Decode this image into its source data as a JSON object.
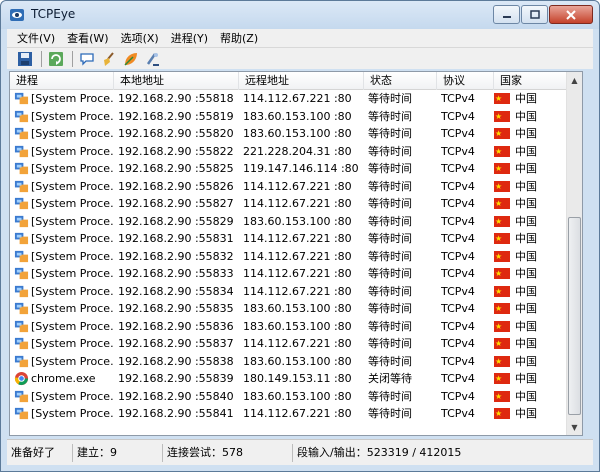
{
  "window": {
    "title": "TCPEye"
  },
  "menu": [
    "文件(V)",
    "查看(W)",
    "选项(X)",
    "进程(Y)",
    "帮助(Z)"
  ],
  "toolbar": [
    "save-icon",
    "refresh-icon",
    "chat-icon",
    "broom-icon",
    "leaf-icon",
    "tool-icon"
  ],
  "columns": [
    "进程",
    "本地地址",
    "远程地址",
    "状态",
    "协议",
    "国家"
  ],
  "rows": [
    {
      "process": "[System Proce...",
      "icon": "system-process-icon",
      "local": "192.168.2.90 :55818",
      "remote": "114.112.67.221 :80",
      "state": "等待时间",
      "protocol": "TCPv4",
      "country": "中国"
    },
    {
      "process": "[System Proce...",
      "icon": "system-process-icon",
      "local": "192.168.2.90 :55819",
      "remote": "183.60.153.100 :80",
      "state": "等待时间",
      "protocol": "TCPv4",
      "country": "中国"
    },
    {
      "process": "[System Proce...",
      "icon": "system-process-icon",
      "local": "192.168.2.90 :55820",
      "remote": "183.60.153.100 :80",
      "state": "等待时间",
      "protocol": "TCPv4",
      "country": "中国"
    },
    {
      "process": "[System Proce...",
      "icon": "system-process-icon",
      "local": "192.168.2.90 :55822",
      "remote": "221.228.204.31 :80",
      "state": "等待时间",
      "protocol": "TCPv4",
      "country": "中国"
    },
    {
      "process": "[System Proce...",
      "icon": "system-process-icon",
      "local": "192.168.2.90 :55825",
      "remote": "119.147.146.114 :80",
      "state": "等待时间",
      "protocol": "TCPv4",
      "country": "中国"
    },
    {
      "process": "[System Proce...",
      "icon": "system-process-icon",
      "local": "192.168.2.90 :55826",
      "remote": "114.112.67.221 :80",
      "state": "等待时间",
      "protocol": "TCPv4",
      "country": "中国"
    },
    {
      "process": "[System Proce...",
      "icon": "system-process-icon",
      "local": "192.168.2.90 :55827",
      "remote": "114.112.67.221 :80",
      "state": "等待时间",
      "protocol": "TCPv4",
      "country": "中国"
    },
    {
      "process": "[System Proce...",
      "icon": "system-process-icon",
      "local": "192.168.2.90 :55829",
      "remote": "183.60.153.100 :80",
      "state": "等待时间",
      "protocol": "TCPv4",
      "country": "中国"
    },
    {
      "process": "[System Proce...",
      "icon": "system-process-icon",
      "local": "192.168.2.90 :55831",
      "remote": "114.112.67.221 :80",
      "state": "等待时间",
      "protocol": "TCPv4",
      "country": "中国"
    },
    {
      "process": "[System Proce...",
      "icon": "system-process-icon",
      "local": "192.168.2.90 :55832",
      "remote": "114.112.67.221 :80",
      "state": "等待时间",
      "protocol": "TCPv4",
      "country": "中国"
    },
    {
      "process": "[System Proce...",
      "icon": "system-process-icon",
      "local": "192.168.2.90 :55833",
      "remote": "114.112.67.221 :80",
      "state": "等待时间",
      "protocol": "TCPv4",
      "country": "中国"
    },
    {
      "process": "[System Proce...",
      "icon": "system-process-icon",
      "local": "192.168.2.90 :55834",
      "remote": "114.112.67.221 :80",
      "state": "等待时间",
      "protocol": "TCPv4",
      "country": "中国"
    },
    {
      "process": "[System Proce...",
      "icon": "system-process-icon",
      "local": "192.168.2.90 :55835",
      "remote": "183.60.153.100 :80",
      "state": "等待时间",
      "protocol": "TCPv4",
      "country": "中国"
    },
    {
      "process": "[System Proce...",
      "icon": "system-process-icon",
      "local": "192.168.2.90 :55836",
      "remote": "183.60.153.100 :80",
      "state": "等待时间",
      "protocol": "TCPv4",
      "country": "中国"
    },
    {
      "process": "[System Proce...",
      "icon": "system-process-icon",
      "local": "192.168.2.90 :55837",
      "remote": "114.112.67.221 :80",
      "state": "等待时间",
      "protocol": "TCPv4",
      "country": "中国"
    },
    {
      "process": "[System Proce...",
      "icon": "system-process-icon",
      "local": "192.168.2.90 :55838",
      "remote": "183.60.153.100 :80",
      "state": "等待时间",
      "protocol": "TCPv4",
      "country": "中国"
    },
    {
      "process": "chrome.exe",
      "icon": "chrome-icon",
      "local": "192.168.2.90 :55839",
      "remote": "180.149.153.11 :80",
      "state": "关闭等待",
      "protocol": "TCPv4",
      "country": "中国"
    },
    {
      "process": "[System Proce...",
      "icon": "system-process-icon",
      "local": "192.168.2.90 :55840",
      "remote": "183.60.153.100 :80",
      "state": "等待时间",
      "protocol": "TCPv4",
      "country": "中国"
    },
    {
      "process": "[System Proce...",
      "icon": "system-process-icon",
      "local": "192.168.2.90 :55841",
      "remote": "114.112.67.221 :80",
      "state": "等待时间",
      "protocol": "TCPv4",
      "country": "中国"
    }
  ],
  "status": {
    "ready": "准备好了",
    "established": "建立：9",
    "attempts": "连接尝试：578",
    "segments": "段输入/输出：523319 / 412015"
  }
}
